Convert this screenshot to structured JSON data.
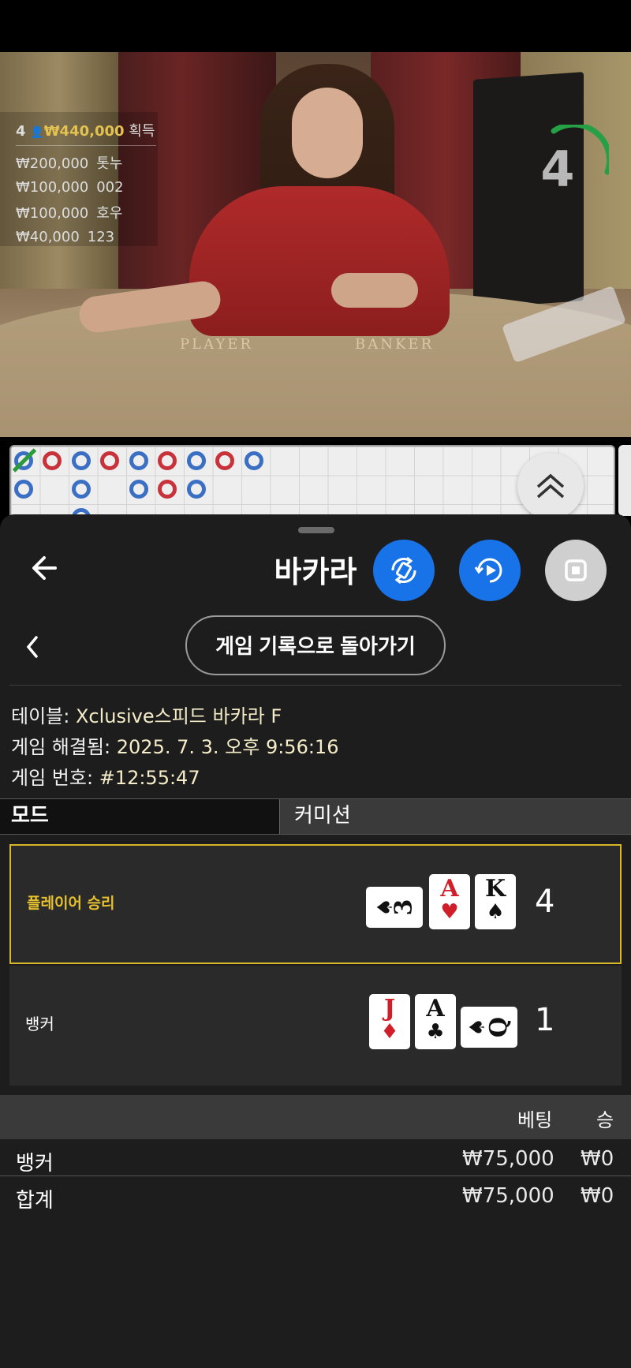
{
  "video": {
    "leaders": {
      "count": "4",
      "top_amount": "₩440,000",
      "top_suffix": "획득",
      "rows": [
        {
          "amount": "₩200,000",
          "name": "톳누"
        },
        {
          "amount": "₩100,000",
          "name": "002"
        },
        {
          "amount": "₩100,000",
          "name": "호우"
        },
        {
          "amount": "₩40,000",
          "name": "123"
        }
      ]
    },
    "timer": "4",
    "felt_player": "PLAYER",
    "felt_banker": "BANKER"
  },
  "sheet": {
    "title": "바카라",
    "history_button": "게임 기록으로 돌아가기",
    "info": {
      "table_label": "테이블:",
      "table_value": "Xclusive스피드 바카라 F",
      "resolved_label": "게임 해결됨:",
      "resolved_value": "2025. 7. 3. 오후 9:56:16",
      "number_label": "게임 번호:",
      "number_value": "#12:55:47"
    },
    "mode": {
      "mode_label": "모드",
      "commission_label": "커미션"
    },
    "player": {
      "label": "플레이어 승리",
      "cards": [
        {
          "rank": "3",
          "suit": "♠",
          "color": "black",
          "sideways": true
        },
        {
          "rank": "A",
          "suit": "♥",
          "color": "red",
          "sideways": false
        },
        {
          "rank": "K",
          "suit": "♠",
          "color": "black",
          "sideways": false
        }
      ],
      "score": "4"
    },
    "banker": {
      "label": "뱅커",
      "cards": [
        {
          "rank": "J",
          "suit": "♦",
          "color": "red",
          "sideways": false
        },
        {
          "rank": "A",
          "suit": "♣",
          "color": "black",
          "sideways": false
        },
        {
          "rank": "Q",
          "suit": "♠",
          "color": "black",
          "sideways": true
        }
      ],
      "score": "1"
    },
    "bets": {
      "header_bet": "베팅",
      "header_win": "승",
      "rows": [
        {
          "name": "뱅커",
          "bet": "₩75,000",
          "win": "₩0"
        },
        {
          "name": "합계",
          "bet": "₩75,000",
          "win": "₩0"
        }
      ]
    }
  },
  "colors": {
    "accent_blue": "#1873e8",
    "gold": "#d7b62a",
    "roadmap_blue": "#3b6fc4",
    "roadmap_red": "#c8333b"
  }
}
